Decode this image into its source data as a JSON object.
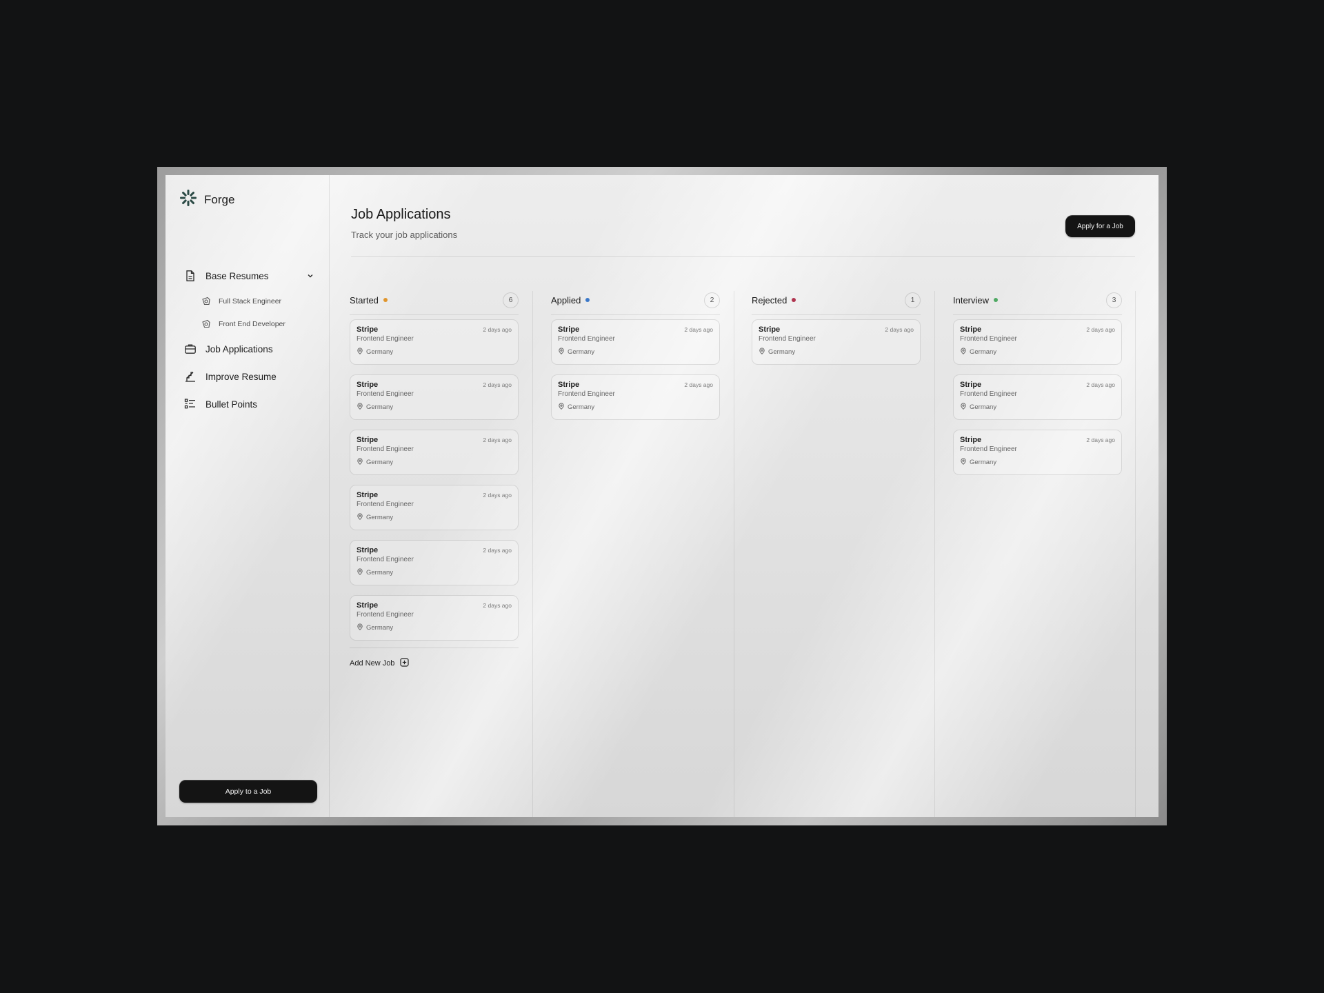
{
  "app": {
    "name": "Forge"
  },
  "sidebar": {
    "items": [
      {
        "label": "Base Resumes",
        "icon": "document-icon"
      },
      {
        "label": "Job Applications",
        "icon": "briefcase-icon"
      },
      {
        "label": "Improve Resume",
        "icon": "chart-step-icon"
      },
      {
        "label": "Bullet Points",
        "icon": "list-icon"
      }
    ],
    "resumes": [
      {
        "label": "Full Stack Engineer",
        "icon": "badge-icon"
      },
      {
        "label": "Front End Developer",
        "icon": "badge-icon"
      }
    ],
    "cta_label": "Apply to a Job"
  },
  "header": {
    "title": "Job Applications",
    "subtitle": "Track your job applications",
    "cta_label": "Apply for a Job"
  },
  "board": {
    "add_label": "Add New Job",
    "columns": [
      {
        "title": "Started",
        "count": "6",
        "dot_color": "#e0952c",
        "cards": [
          {
            "company": "Stripe",
            "role": "Frontend Engineer",
            "location": "Germany",
            "time": "2 days ago"
          },
          {
            "company": "Stripe",
            "role": "Frontend Engineer",
            "location": "Germany",
            "time": "2 days ago"
          },
          {
            "company": "Stripe",
            "role": "Frontend Engineer",
            "location": "Germany",
            "time": "2 days ago"
          },
          {
            "company": "Stripe",
            "role": "Frontend Engineer",
            "location": "Germany",
            "time": "2 days ago"
          },
          {
            "company": "Stripe",
            "role": "Frontend Engineer",
            "location": "Germany",
            "time": "2 days ago"
          },
          {
            "company": "Stripe",
            "role": "Frontend Engineer",
            "location": "Germany",
            "time": "2 days ago"
          }
        ]
      },
      {
        "title": "Applied",
        "count": "2",
        "dot_color": "#3b78c9",
        "cards": [
          {
            "company": "Stripe",
            "role": "Frontend Engineer",
            "location": "Germany",
            "time": "2 days ago"
          },
          {
            "company": "Stripe",
            "role": "Frontend Engineer",
            "location": "Germany",
            "time": "2 days ago"
          }
        ]
      },
      {
        "title": "Rejected",
        "count": "1",
        "dot_color": "#b0344f",
        "cards": [
          {
            "company": "Stripe",
            "role": "Frontend Engineer",
            "location": "Germany",
            "time": "2 days ago"
          }
        ]
      },
      {
        "title": "Interview",
        "count": "3",
        "dot_color": "#4fa963",
        "cards": [
          {
            "company": "Stripe",
            "role": "Frontend Engineer",
            "location": "Germany",
            "time": "2 days ago"
          },
          {
            "company": "Stripe",
            "role": "Frontend Engineer",
            "location": "Germany",
            "time": "2 days ago"
          },
          {
            "company": "Stripe",
            "role": "Frontend Engineer",
            "location": "Germany",
            "time": "2 days ago"
          }
        ]
      }
    ]
  }
}
